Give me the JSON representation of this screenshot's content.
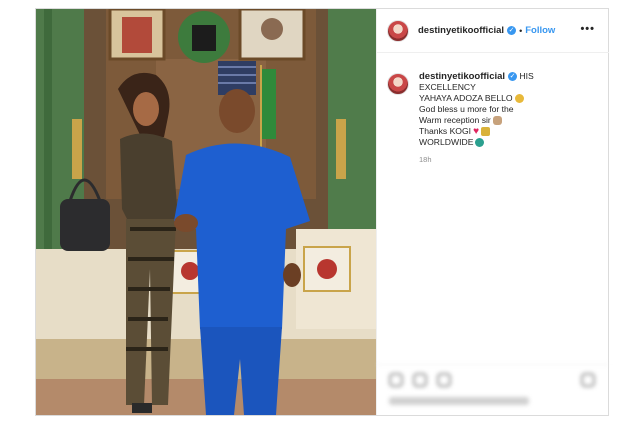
{
  "post": {
    "username": "destinyetikoofficial",
    "separator": "•",
    "follow_label": "Follow",
    "more_label": "•••",
    "caption_lines": [
      "HIS",
      "EXCELLENCY",
      "YAHAYA ADOZA BELLO",
      "God bless u more for the",
      "Warm reception sir",
      "Thanks KOGI",
      "WORLDWIDE"
    ],
    "time_ago": "18h"
  },
  "icons": {
    "verified": "verified-badge-icon",
    "more": "more-options-icon",
    "like": "heart-icon",
    "comment": "comment-icon",
    "share": "share-icon",
    "save": "bookmark-icon"
  },
  "colors": {
    "link_blue": "#3897f0",
    "agbada_blue": "#1e5fd0",
    "text": "#262626",
    "muted": "#8e8e8e"
  }
}
